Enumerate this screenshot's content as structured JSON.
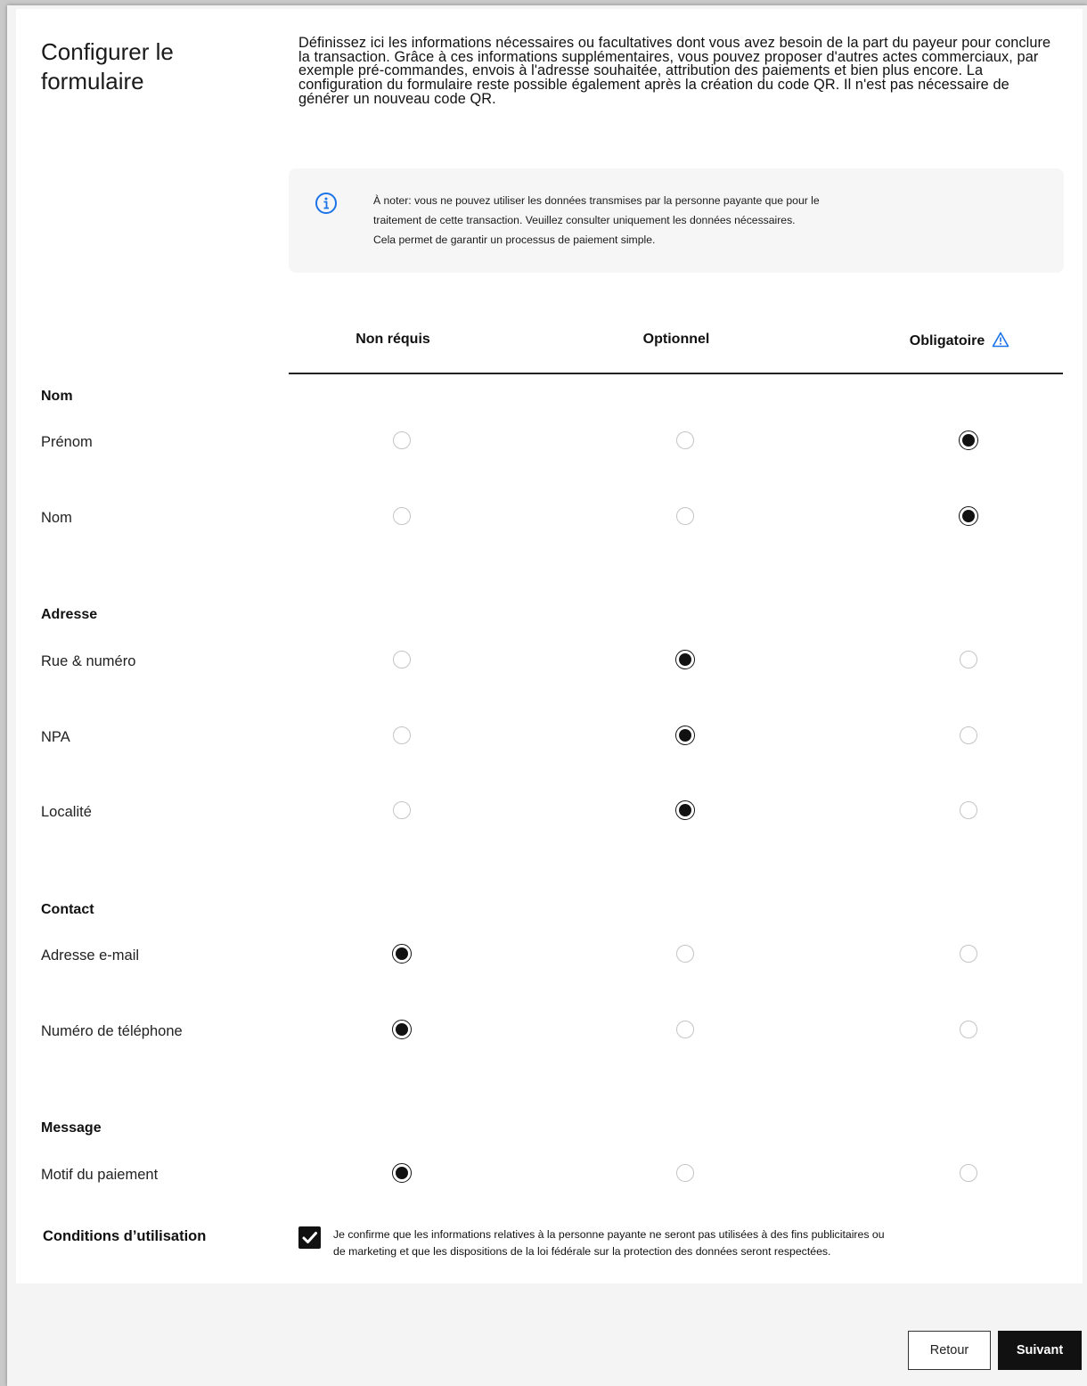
{
  "header": {
    "title": "Configurer le formulaire",
    "intro": "Définissez ici les informations nécessaires ou facultatives dont vous avez besoin de la part du payeur pour conclure la transaction. Grâce à ces informations supplémentaires, vous pouvez proposer d'autres actes commerciaux, par exemple pré-commandes, envois à l'adresse souhaitée, attribution des paiements et bien plus encore. La configuration du formulaire reste possible également après la création du code QR. Il n'est pas nécessaire de générer un nouveau code QR."
  },
  "note": {
    "icon": "info-icon",
    "line1": "À noter: vous ne pouvez utiliser les données transmises par la personne payante que pour le",
    "line2": "traitement de cette transaction. Veuillez consulter uniquement les données nécessaires.",
    "line3": "Cela permet de garantir un processus de paiement simple."
  },
  "columns": {
    "not_required": "Non réquis",
    "optional": "Optionnel",
    "mandatory": "Obligatoire",
    "mandatory_icon": "warning-icon"
  },
  "sections": {
    "name": {
      "title": "Nom",
      "rows": [
        {
          "label": "Prénom",
          "selected": "mandatory"
        },
        {
          "label": "Nom",
          "selected": "mandatory"
        }
      ]
    },
    "address": {
      "title": "Adresse",
      "rows": [
        {
          "label": "Rue & numéro",
          "selected": "optional"
        },
        {
          "label": "NPA",
          "selected": "optional"
        },
        {
          "label": "Localité",
          "selected": "optional"
        }
      ]
    },
    "contact": {
      "title": "Contact",
      "rows": [
        {
          "label": "Adresse e-mail",
          "selected": "not_required"
        },
        {
          "label": "Numéro de téléphone",
          "selected": "not_required"
        }
      ]
    },
    "message": {
      "title": "Message",
      "rows": [
        {
          "label": "Motif du paiement",
          "selected": "not_required"
        }
      ]
    }
  },
  "terms": {
    "title": "Conditions d’utilisation",
    "checked": true,
    "line1": "Je confirme que les informations relatives à la personne payante ne seront pas utilisées à des fins publicitaires ou",
    "line2": "de marketing et que les dispositions de la loi fédérale sur la protection des données seront respectées."
  },
  "footer": {
    "back_label": "Retour",
    "next_label": "Suivant"
  },
  "colors": {
    "accent_info": "#1a73e8",
    "primary_button": "#111111"
  }
}
